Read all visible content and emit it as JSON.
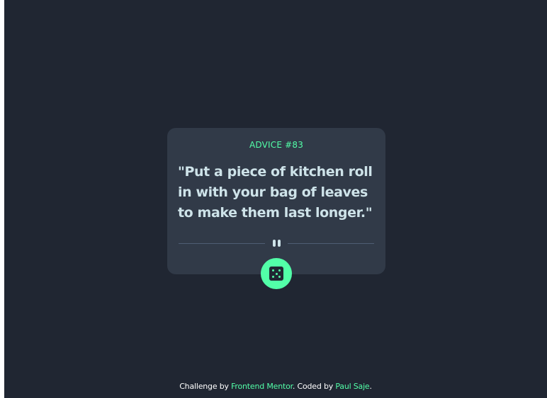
{
  "card": {
    "advice_id": "ADVICE #83",
    "quote": "\"Put a piece of kitchen roll in with your bag of leaves to make them last longer.\""
  },
  "divider": {
    "icon": "pause-icon"
  },
  "dice_button": {
    "icon": "dice-icon"
  },
  "footer": {
    "prefix": "Challenge by ",
    "link1": "Frontend Mentor",
    "middle": ". Coded by ",
    "link2": "Paul Saje",
    "suffix": "."
  },
  "colors": {
    "background": "#202632",
    "card": "#313a48",
    "accent": "#52ffa8",
    "text": "#cee3e9",
    "divider": "#4f5d74"
  }
}
